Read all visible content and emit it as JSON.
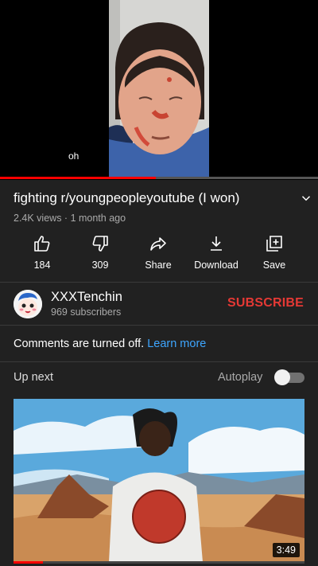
{
  "player": {
    "caption": "oh",
    "progress_fraction": 0.49,
    "progress_color": "#ff0000"
  },
  "video": {
    "title": "fighting r/youngpeopleyoutube (I won)",
    "views": "2.4K views",
    "separator": " · ",
    "age": "1 month ago",
    "expand_icon": "chevron-down-icon"
  },
  "actions": [
    {
      "icon": "thumbs-up-icon",
      "label": "184"
    },
    {
      "icon": "thumbs-down-icon",
      "label": "309"
    },
    {
      "icon": "share-icon",
      "label": "Share"
    },
    {
      "icon": "download-icon",
      "label": "Download"
    },
    {
      "icon": "save-to-playlist-icon",
      "label": "Save"
    }
  ],
  "channel": {
    "name": "XXXTenchin",
    "subscribers": "969 subscribers",
    "subscribe_label": "SUBSCRIBE",
    "subscribe_color": "#e53935"
  },
  "comments": {
    "text": "Comments are turned off.",
    "link": "Learn more",
    "link_color": "#3ea6ff"
  },
  "up_next": {
    "label": "Up next",
    "autoplay_label": "Autoplay",
    "autoplay_on": false
  },
  "next_video": {
    "duration": "3:49",
    "watched_fraction": 0.1
  },
  "theme": {
    "background": "#212121",
    "accent": "#ff0000"
  }
}
